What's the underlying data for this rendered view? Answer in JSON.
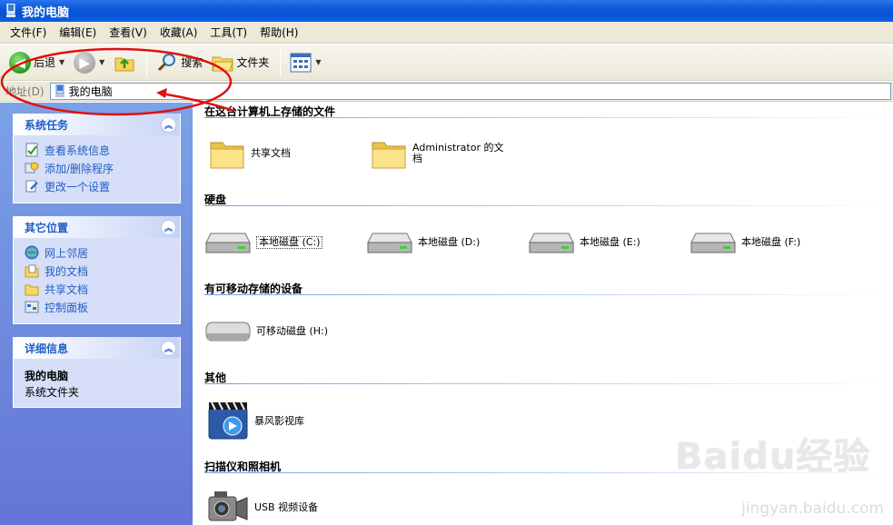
{
  "window": {
    "title": "我的电脑"
  },
  "menu": [
    "文件(F)",
    "编辑(E)",
    "查看(V)",
    "收藏(A)",
    "工具(T)",
    "帮助(H)"
  ],
  "toolbar": {
    "back_label": "后退",
    "search_label": "搜索",
    "folders_label": "文件夹"
  },
  "address": {
    "label": "地址(D)",
    "value": "我的电脑"
  },
  "panels": {
    "system_tasks": {
      "title": "系统任务",
      "items": [
        "查看系统信息",
        "添加/删除程序",
        "更改一个设置"
      ]
    },
    "other_places": {
      "title": "其它位置",
      "items": [
        "网上邻居",
        "我的文档",
        "共享文档",
        "控制面板"
      ]
    },
    "details": {
      "title": "详细信息",
      "name": "我的电脑",
      "type": "系统文件夹"
    }
  },
  "groups": {
    "files": {
      "header": "在这台计算机上存储的文件",
      "items": [
        "共享文档",
        "Administrator 的文",
        "档"
      ]
    },
    "hard_disks": {
      "header": "硬盘",
      "items": [
        "本地磁盘 (C:)",
        "本地磁盘 (D:)",
        "本地磁盘 (E:)",
        "本地磁盘 (F:)"
      ]
    },
    "removable": {
      "header": "有可移动存储的设备",
      "items": [
        "可移动磁盘 (H:)"
      ]
    },
    "other": {
      "header": "其他",
      "items": [
        "暴风影视库"
      ]
    },
    "scanners": {
      "header": "扫描仪和照相机",
      "items": [
        "USB 视频设备"
      ]
    }
  },
  "watermark": {
    "logo": "Baidu经验",
    "url": "jingyan.baidu.com"
  },
  "colors": {
    "title_bar": "#0a58d8",
    "task_link": "#215dc6",
    "annotation": "#e01010"
  }
}
